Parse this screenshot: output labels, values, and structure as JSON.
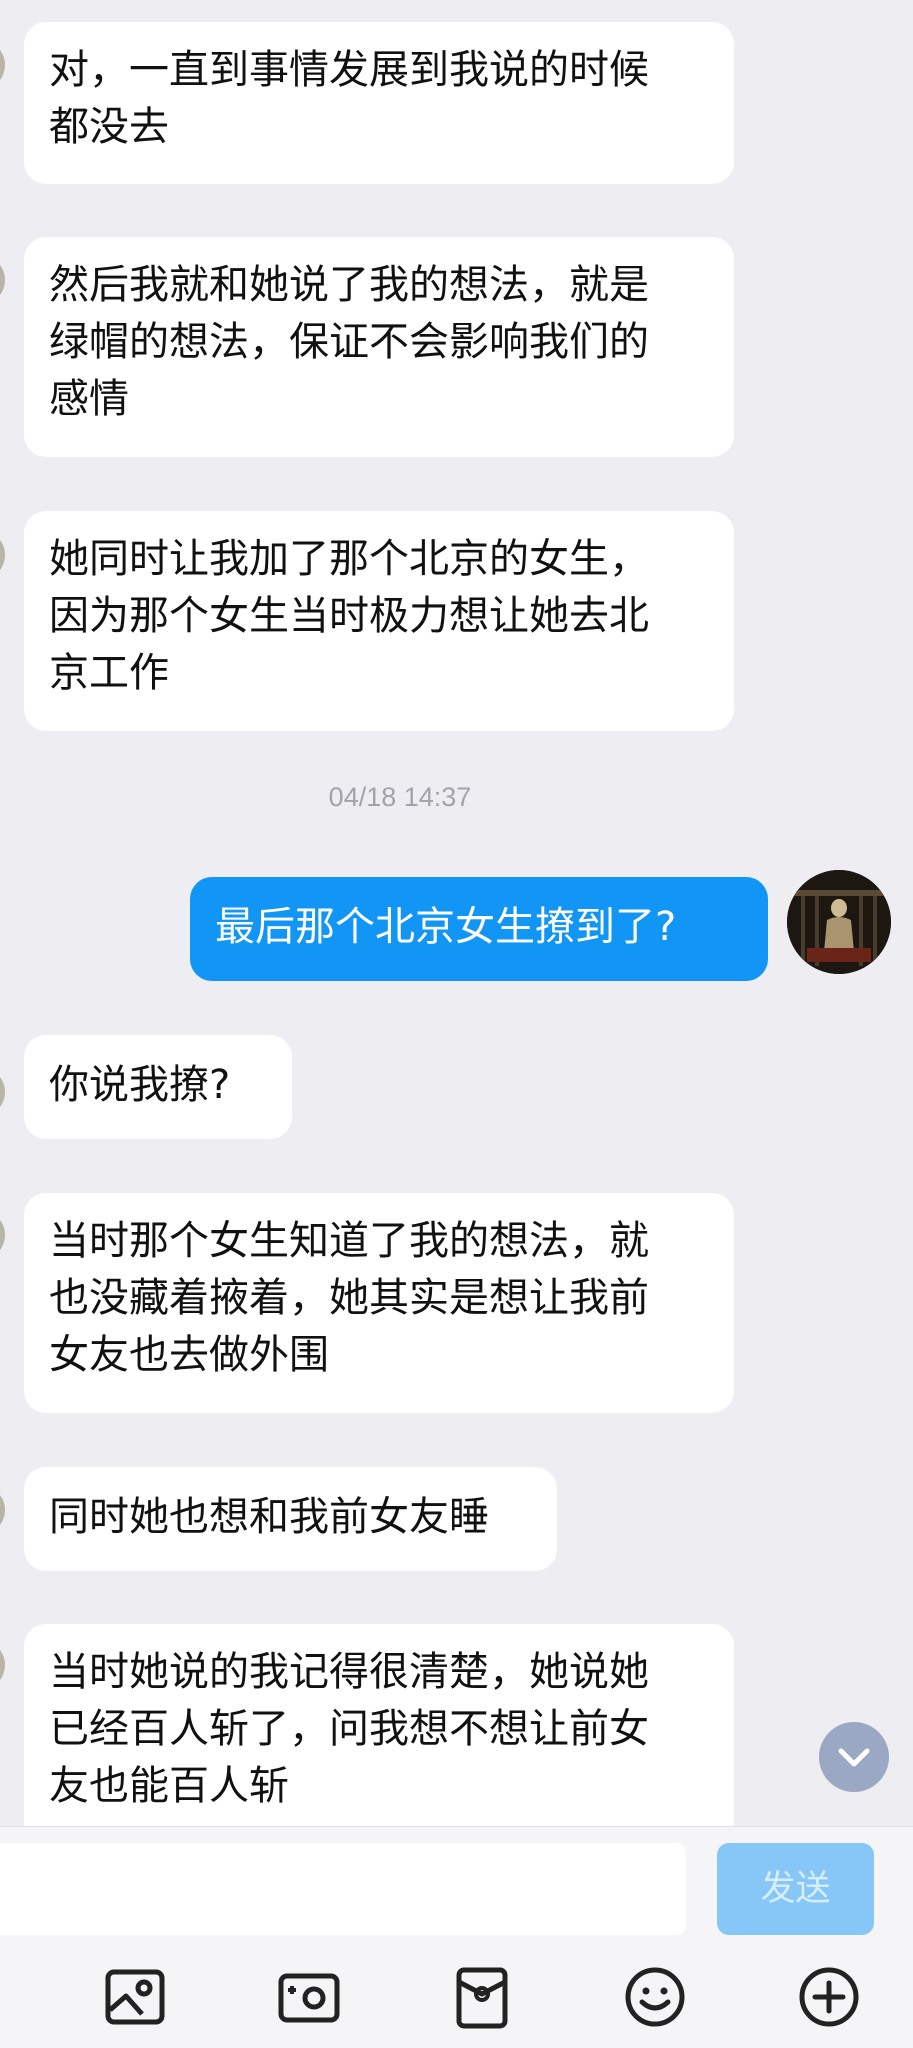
{
  "messages": [
    {
      "sender": "other",
      "text": "对，一直到事情发展到我说的时候\n都没去"
    },
    {
      "sender": "other",
      "text": "然后我就和她说了我的想法，就是\n绿帽的想法，保证不会影响我们的\n感情"
    },
    {
      "sender": "other",
      "text": "她同时让我加了那个北京的女生，\n因为那个女生当时极力想让她去北\n京工作"
    },
    {
      "sender": "me",
      "text": "最后那个北京女生撩到了?"
    },
    {
      "sender": "other",
      "text": "你说我撩?"
    },
    {
      "sender": "other",
      "text": "当时那个女生知道了我的想法，就\n也没藏着掖着，她其实是想让我前\n女友也去做外围"
    },
    {
      "sender": "other",
      "text": "同时她也想和我前女友睡"
    },
    {
      "sender": "other",
      "text": "当时她说的我记得很清楚，她说她\n已经百人斩了，问我想不想让前女\n友也能百人斩"
    }
  ],
  "timestamp": "04/18 14:37",
  "input": {
    "value": "",
    "send_label": "发送"
  },
  "toolbar": {
    "icons": [
      "image-icon",
      "camera-icon",
      "red-packet-icon",
      "emoji-icon",
      "plus-icon"
    ]
  },
  "colors": {
    "background": "#ededf2",
    "incoming_bubble": "#ffffff",
    "outgoing_bubble": "#1296f5",
    "send_button": "#87c7f8"
  }
}
